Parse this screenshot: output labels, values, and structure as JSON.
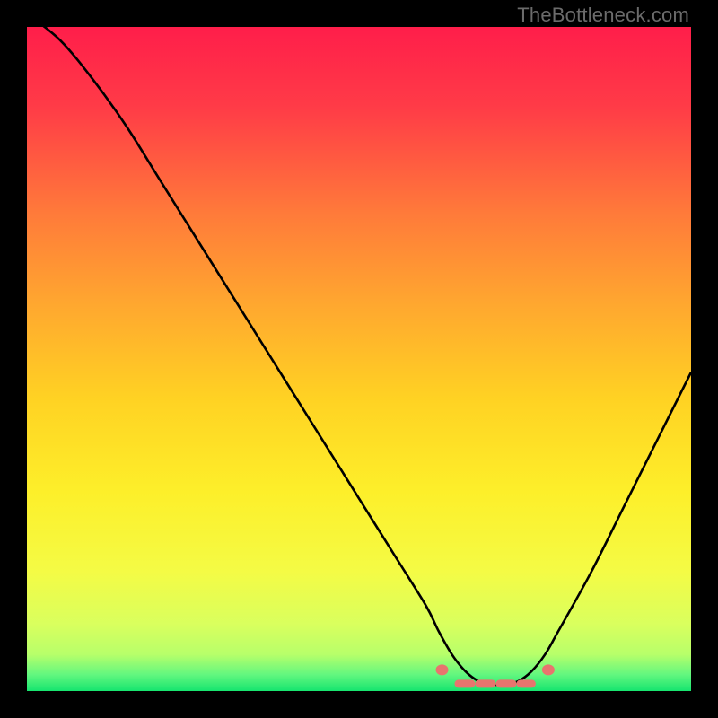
{
  "watermark": "TheBottleneck.com",
  "chart_data": {
    "type": "line",
    "title": "",
    "xlabel": "",
    "ylabel": "",
    "xlim": [
      0,
      100
    ],
    "ylim": [
      0,
      100
    ],
    "series": [
      {
        "name": "bottleneck-curve",
        "x": [
          0,
          5,
          10,
          15,
          20,
          25,
          30,
          35,
          40,
          45,
          50,
          55,
          60,
          62,
          64,
          66,
          68,
          70,
          72,
          74,
          76,
          78,
          80,
          85,
          90,
          95,
          100
        ],
        "y": [
          102,
          98,
          92,
          85,
          77,
          69,
          61,
          53,
          45,
          37,
          29,
          21,
          13,
          9,
          5.5,
          3,
          1.5,
          1,
          1,
          1.5,
          3,
          5.5,
          9,
          18,
          28,
          38,
          48
        ]
      }
    ],
    "markers": {
      "dots_x": [
        62.5,
        78.5
      ],
      "dots_y": [
        3.2,
        3.2
      ],
      "band_x": [
        65,
        76
      ],
      "band_y": 1.1
    },
    "gradient_stops": [
      {
        "offset": 0.0,
        "color": "#ff1e4a"
      },
      {
        "offset": 0.12,
        "color": "#ff3b47"
      },
      {
        "offset": 0.28,
        "color": "#ff7a3a"
      },
      {
        "offset": 0.42,
        "color": "#ffa82f"
      },
      {
        "offset": 0.56,
        "color": "#ffd223"
      },
      {
        "offset": 0.7,
        "color": "#fdef2a"
      },
      {
        "offset": 0.82,
        "color": "#f4fb45"
      },
      {
        "offset": 0.9,
        "color": "#d9ff5e"
      },
      {
        "offset": 0.945,
        "color": "#b7ff6a"
      },
      {
        "offset": 0.975,
        "color": "#63f77f"
      },
      {
        "offset": 1.0,
        "color": "#16e56f"
      }
    ]
  }
}
